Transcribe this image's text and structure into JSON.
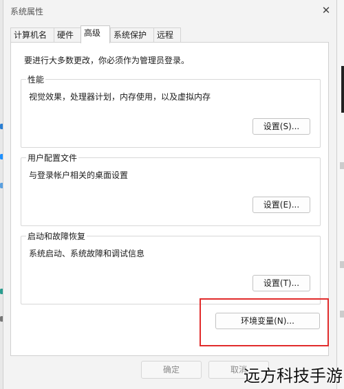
{
  "window": {
    "title": "系统属性"
  },
  "tabs": [
    {
      "label": "计算机名"
    },
    {
      "label": "硬件"
    },
    {
      "label": "高级"
    },
    {
      "label": "系统保护"
    },
    {
      "label": "远程"
    }
  ],
  "active_tab": "高级",
  "intro": "要进行大多数更改，你必须作为管理员登录。",
  "groups": {
    "performance": {
      "title": "性能",
      "desc": "视觉效果，处理器计划，内存使用，以及虚拟内存",
      "button": "设置(S)..."
    },
    "profiles": {
      "title": "用户配置文件",
      "desc": "与登录帐户相关的桌面设置",
      "button": "设置(E)..."
    },
    "startup": {
      "title": "启动和故障恢复",
      "desc": "系统启动、系统故障和调试信息",
      "button": "设置(T)..."
    }
  },
  "env_button": "环境变量(N)...",
  "footer": {
    "ok": "确定",
    "cancel": "取消"
  },
  "watermark": "远方科技手游",
  "colors": {
    "highlight_border": "#e12a2a",
    "panel_bg": "#ffffff"
  }
}
